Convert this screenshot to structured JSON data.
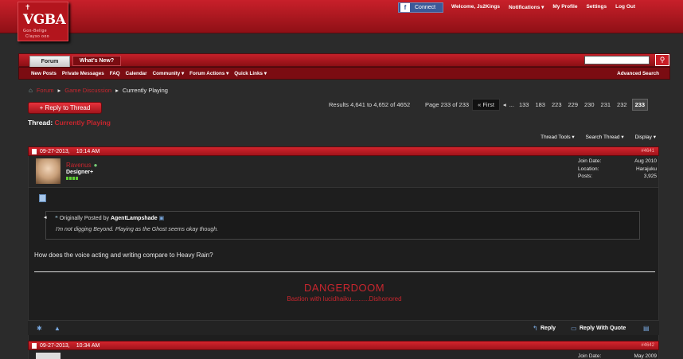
{
  "header": {
    "logo_text": "VGBA",
    "logo_tagline_1": "Gon-Bellge",
    "logo_tagline_2": "Clayso ooo",
    "connect_label": "Connect",
    "welcome": "Welcome,",
    "username": "Js2Kings",
    "links": [
      "Notifications ▾",
      "My Profile",
      "Settings",
      "Log Out"
    ]
  },
  "nav": {
    "tabs": [
      "Forum",
      "What's New?"
    ],
    "sublinks": [
      "New Posts",
      "Private Messages",
      "FAQ",
      "Calendar",
      "Community ▾",
      "Forum Actions ▾",
      "Quick Links ▾"
    ],
    "advanced_search": "Advanced Search"
  },
  "breadcrumb": [
    "Forum",
    "Game Discussion",
    "Currently Playing"
  ],
  "reply_button": "+ Reply to Thread",
  "thread": {
    "label": "Thread:",
    "title": "Currently Playing"
  },
  "results_text": "Results 4,641 to 4,652 of 4652",
  "pager": {
    "page_info": "Page 233 of 233",
    "first": "First",
    "ellipsis": "...",
    "pages": [
      "133",
      "183",
      "223",
      "229",
      "230",
      "231",
      "232"
    ],
    "current": "233"
  },
  "thread_tools": [
    "Thread Tools ▾",
    "Search Thread ▾",
    "Display ▾"
  ],
  "post": {
    "date": "09-27-2013,",
    "time": "10:14 AM",
    "post_number": "#4641",
    "username": "Ravenus",
    "user_title": "Designer+",
    "join_label": "Join Date:",
    "join_value": "Aug 2010",
    "location_label": "Location:",
    "location_value": "Harajuku",
    "posts_label": "Posts:",
    "posts_value": "3,925",
    "quote_prefix": "Originally Posted by",
    "quote_author": "AgentLampshade",
    "quote_text": "I'm not digging Beyond. Playing as the Ghost seems okay though.",
    "message": "How does the voice acting and writing compare to Heavy Rain?",
    "signature_title": "DANGERDOOM",
    "signature_sub": "Bastion with lucidhaiku..........Dishonored",
    "reply_label": "Reply",
    "reply_quote_label": "Reply With Quote"
  },
  "post2": {
    "date": "09-27-2013,",
    "time": "10:34 AM",
    "post_number": "#4642",
    "join_label": "Join Date:",
    "join_value": "May 2009"
  }
}
